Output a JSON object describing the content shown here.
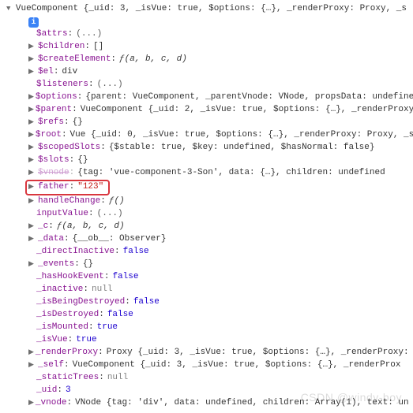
{
  "header": {
    "summary": "VueComponent {_uid: 3, _isVue: true, $options: {…}, _renderProxy: Proxy, _s"
  },
  "props": {
    "attrs": {
      "k": "$attrs",
      "v": "(...)"
    },
    "children": {
      "k": "$children",
      "v": "[]"
    },
    "createElement": {
      "k": "$createElement",
      "fn": "ƒ",
      "args": "(a, b, c, d)"
    },
    "el": {
      "k": "$el",
      "v": "div"
    },
    "listeners": {
      "k": "$listeners",
      "v": "(...)"
    },
    "options": {
      "k": "$options",
      "v": "{parent: VueComponent, _parentVnode: VNode, propsData: undefine"
    },
    "parent": {
      "k": "$parent",
      "v": "VueComponent {_uid: 2, _isVue: true, $options: {…}, _renderProxy"
    },
    "refs": {
      "k": "$refs",
      "v": "{}"
    },
    "root": {
      "k": "$root",
      "v": "Vue {_uid: 0, _isVue: true, $options: {…}, _renderProxy: Proxy, _s"
    },
    "scopedSlots": {
      "k": "$scopedSlots",
      "v": "{$stable: true, $key: undefined, $hasNormal: false}"
    },
    "slots": {
      "k": "$slots",
      "v": "{}"
    },
    "vnode": {
      "k": "$vnode",
      "v": "{tag: 'vue-component-3-Son', data: {…}, children: undefined"
    },
    "father": {
      "k": "father",
      "v": "\"123\""
    },
    "handleChange": {
      "k": "handleChange",
      "fn": "ƒ",
      "args": "()"
    },
    "inputValue": {
      "k": "inputValue",
      "v": "(...)"
    },
    "_c": {
      "k": "_c",
      "fn": "ƒ",
      "args": "(a, b, c, d)"
    },
    "_data": {
      "k": "_data",
      "v": "{__ob__: Observer}"
    },
    "_directInactive": {
      "k": "_directInactive",
      "v": "false"
    },
    "_events": {
      "k": "_events",
      "v": "{}"
    },
    "_hasHookEvent": {
      "k": "_hasHookEvent",
      "v": "false"
    },
    "_inactive": {
      "k": "_inactive",
      "v": "null"
    },
    "_isBeingDestroyed": {
      "k": "_isBeingDestroyed",
      "v": "false"
    },
    "_isDestroyed": {
      "k": "_isDestroyed",
      "v": "false"
    },
    "_isMounted": {
      "k": "_isMounted",
      "v": "true"
    },
    "_isVue": {
      "k": "_isVue",
      "v": "true"
    },
    "_renderProxy": {
      "k": "_renderProxy",
      "v": "Proxy {_uid: 3, _isVue: true, $options: {…}, _renderProxy:"
    },
    "_self": {
      "k": "_self",
      "v": "VueComponent {_uid: 3, _isVue: true, $options: {…}, _renderProx"
    },
    "_staticTrees": {
      "k": "_staticTrees",
      "v": "null"
    },
    "_uid": {
      "k": "_uid",
      "v": "3"
    },
    "_vnode_bottom": {
      "k": "_vnode",
      "v": "VNode {tag: 'div', data: undefined, children: Array(1), text: un"
    }
  },
  "watermark": "CSDN @windy-boy"
}
